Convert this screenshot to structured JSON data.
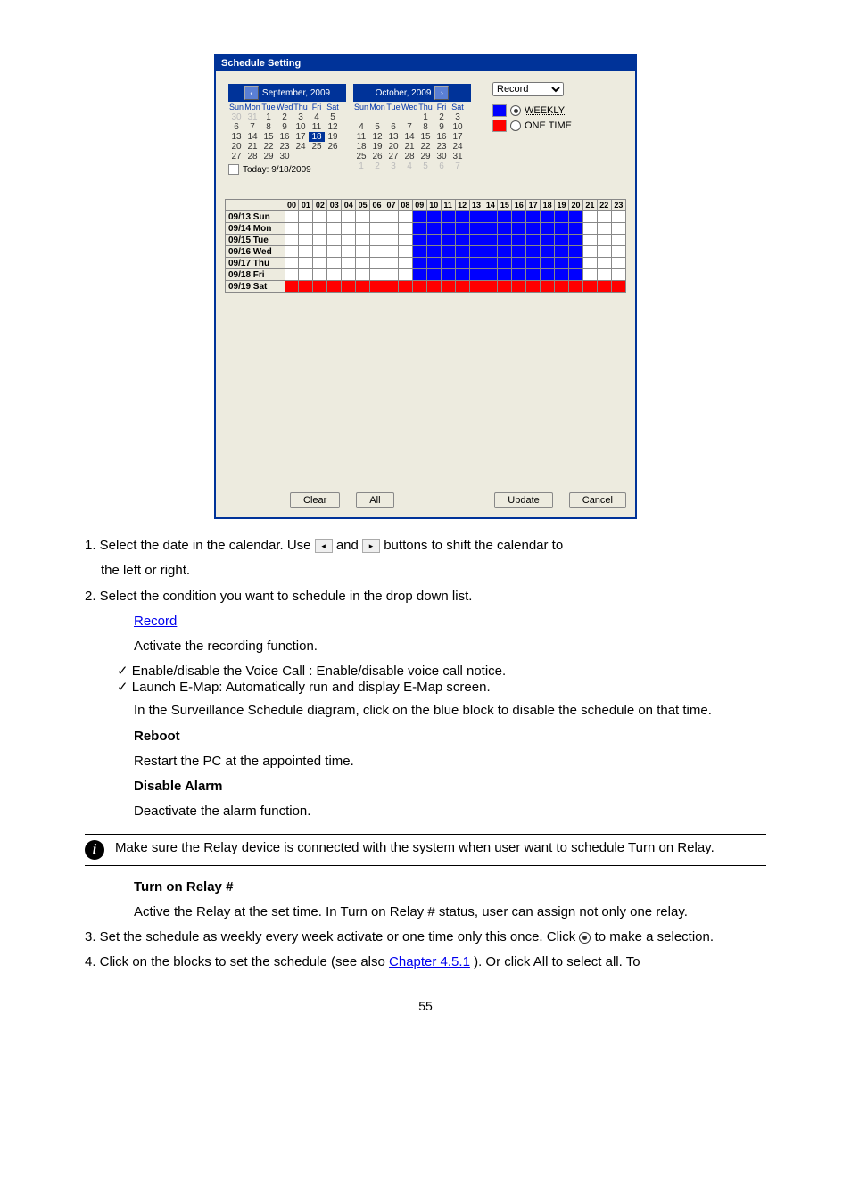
{
  "window": {
    "title": "Schedule Setting"
  },
  "calendar": {
    "prev_glyph": "‹",
    "next_glyph": "›",
    "left_title": "September, 2009",
    "right_title": "October, 2009",
    "weekdays": [
      "Sun",
      "Mon",
      "Tue",
      "Wed",
      "Thu",
      "Fri",
      "Sat"
    ],
    "left_days": [
      {
        "n": "30",
        "dim": true
      },
      {
        "n": "31",
        "dim": true
      },
      {
        "n": "1"
      },
      {
        "n": "2"
      },
      {
        "n": "3"
      },
      {
        "n": "4"
      },
      {
        "n": "5"
      },
      {
        "n": "6"
      },
      {
        "n": "7"
      },
      {
        "n": "8"
      },
      {
        "n": "9"
      },
      {
        "n": "10"
      },
      {
        "n": "11"
      },
      {
        "n": "12"
      },
      {
        "n": "13"
      },
      {
        "n": "14"
      },
      {
        "n": "15"
      },
      {
        "n": "16"
      },
      {
        "n": "17"
      },
      {
        "n": "18",
        "today": true
      },
      {
        "n": "19"
      },
      {
        "n": "20"
      },
      {
        "n": "21"
      },
      {
        "n": "22"
      },
      {
        "n": "23"
      },
      {
        "n": "24"
      },
      {
        "n": "25"
      },
      {
        "n": "26"
      },
      {
        "n": "27"
      },
      {
        "n": "28"
      },
      {
        "n": "29"
      },
      {
        "n": "30"
      },
      {
        "n": ""
      },
      {
        "n": ""
      },
      {
        "n": ""
      }
    ],
    "right_days": [
      {
        "n": ""
      },
      {
        "n": ""
      },
      {
        "n": ""
      },
      {
        "n": ""
      },
      {
        "n": "1"
      },
      {
        "n": "2"
      },
      {
        "n": "3"
      },
      {
        "n": "4"
      },
      {
        "n": "5"
      },
      {
        "n": "6"
      },
      {
        "n": "7"
      },
      {
        "n": "8"
      },
      {
        "n": "9"
      },
      {
        "n": "10"
      },
      {
        "n": "11"
      },
      {
        "n": "12"
      },
      {
        "n": "13"
      },
      {
        "n": "14"
      },
      {
        "n": "15"
      },
      {
        "n": "16"
      },
      {
        "n": "17"
      },
      {
        "n": "18"
      },
      {
        "n": "19"
      },
      {
        "n": "20"
      },
      {
        "n": "21"
      },
      {
        "n": "22"
      },
      {
        "n": "23"
      },
      {
        "n": "24"
      },
      {
        "n": "25"
      },
      {
        "n": "26"
      },
      {
        "n": "27"
      },
      {
        "n": "28"
      },
      {
        "n": "29"
      },
      {
        "n": "30"
      },
      {
        "n": "31"
      },
      {
        "n": "1",
        "dim": true
      },
      {
        "n": "2",
        "dim": true
      },
      {
        "n": "3",
        "dim": true
      },
      {
        "n": "4",
        "dim": true
      },
      {
        "n": "5",
        "dim": true
      },
      {
        "n": "6",
        "dim": true
      },
      {
        "n": "7",
        "dim": true
      }
    ],
    "today_label": "Today: 9/18/2009"
  },
  "legend": {
    "dropdown": "Record",
    "weekly_color": "#0000ff",
    "weekly_label": "WEEKLY",
    "onetime_color": "#ff0000",
    "onetime_label": "ONE TIME"
  },
  "schedule": {
    "hours": [
      "00",
      "01",
      "02",
      "03",
      "04",
      "05",
      "06",
      "07",
      "08",
      "09",
      "10",
      "11",
      "12",
      "13",
      "14",
      "15",
      "16",
      "17",
      "18",
      "19",
      "20",
      "21",
      "22",
      "23"
    ],
    "rows": [
      {
        "label": "09/13 Sun",
        "cells": [
          "",
          "",
          "",
          "",
          "",
          "",
          "",
          "",
          "",
          "b",
          "b",
          "b",
          "b",
          "b",
          "b",
          "b",
          "b",
          "b",
          "b",
          "b",
          "b",
          "",
          "",
          ""
        ]
      },
      {
        "label": "09/14 Mon",
        "cells": [
          "",
          "",
          "",
          "",
          "",
          "",
          "",
          "",
          "",
          "b",
          "b",
          "b",
          "b",
          "b",
          "b",
          "b",
          "b",
          "b",
          "b",
          "b",
          "b",
          "",
          "",
          ""
        ]
      },
      {
        "label": "09/15 Tue",
        "cells": [
          "",
          "",
          "",
          "",
          "",
          "",
          "",
          "",
          "",
          "b",
          "b",
          "b",
          "b",
          "b",
          "b",
          "b",
          "b",
          "b",
          "b",
          "b",
          "b",
          "",
          "",
          ""
        ]
      },
      {
        "label": "09/16 Wed",
        "cells": [
          "",
          "",
          "",
          "",
          "",
          "",
          "",
          "",
          "",
          "b",
          "b",
          "b",
          "b",
          "b",
          "b",
          "b",
          "b",
          "b",
          "b",
          "b",
          "b",
          "",
          "",
          ""
        ]
      },
      {
        "label": "09/17 Thu",
        "cells": [
          "",
          "",
          "",
          "",
          "",
          "",
          "",
          "",
          "",
          "b",
          "b",
          "b",
          "b",
          "b",
          "b",
          "b",
          "b",
          "b",
          "b",
          "b",
          "b",
          "",
          "",
          ""
        ]
      },
      {
        "label": "09/18 Fri",
        "cells": [
          "",
          "",
          "",
          "",
          "",
          "",
          "",
          "",
          "",
          "b",
          "b",
          "b",
          "b",
          "b",
          "b",
          "b",
          "b",
          "b",
          "b",
          "b",
          "b",
          "",
          "",
          ""
        ]
      },
      {
        "label": "09/19 Sat",
        "cells": [
          "r",
          "r",
          "r",
          "r",
          "r",
          "r",
          "r",
          "r",
          "r",
          "r",
          "r",
          "r",
          "r",
          "r",
          "r",
          "r",
          "r",
          "r",
          "r",
          "r",
          "r",
          "r",
          "r",
          "r"
        ]
      }
    ]
  },
  "buttons": {
    "clear": "Clear",
    "all": "All",
    "update": "Update",
    "cancel": "Cancel"
  },
  "doc": {
    "p1a": "1. Select the date in the calendar. Use ",
    "p1b": " and ",
    "p1c": " buttons to shift the calendar to",
    "p1d": "the left or right.",
    "p2": "2. Select the condition you want to schedule in the drop down list.",
    "record_head": "Record",
    "record_body": "Activate the recording function.",
    "check1": "Enable/disable the Voice Call : Enable/disable voice call notice.",
    "check2": "Launch E-Map: Automatically run and display E-Map screen.",
    "p_launch_desc": "In the Surveillance Schedule diagram, click on the blue block to disable the schedule on that time.",
    "reboot_head": "Reboot",
    "reboot_body": "Restart the PC at the appointed time.",
    "disable_head": "Disable Alarm",
    "disable_body": "Deactivate the alarm function.",
    "turnon_head": "Turn on Relay #",
    "turnon_body": "Active the Relay at the set time. In Turn on Relay # status, user can assign not only one relay.",
    "note": "Make sure the Relay device is connected with the system when user want to schedule Turn on Relay.",
    "p3a": "3. Set the schedule as weekly every week activate or one time only this once. Click ",
    "p3b": " to make a selection.",
    "p4": "4. Click on the blocks to set the schedule (see also ",
    "p4_link": "Chapter 4.5.1",
    "p4b": "). Or click All to select all. To",
    "pagenum": "55"
  }
}
